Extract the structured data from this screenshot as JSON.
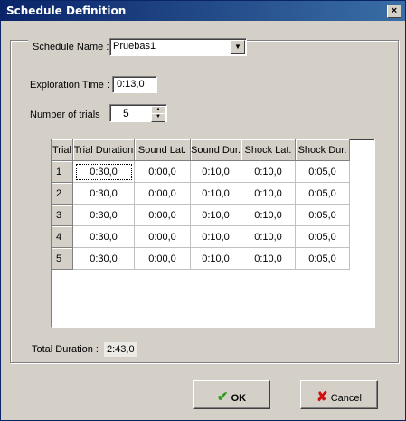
{
  "window": {
    "title": "Schedule Definition",
    "close_glyph": "×"
  },
  "schedule": {
    "label": "Schedule Name :",
    "value": "Pruebas1",
    "arrow_glyph": "▼"
  },
  "exploration": {
    "label": "Exploration Time :",
    "value": "0:13,0"
  },
  "trials": {
    "label": "Number of trials",
    "value": "5",
    "up_glyph": "▲",
    "down_glyph": "▼"
  },
  "grid": {
    "headers": [
      "Trial",
      "Trial Duration",
      "Sound Lat.",
      "Sound Dur.",
      "Shock Lat.",
      "Shock Dur."
    ],
    "rows": [
      [
        "1",
        "0:30,0",
        "0:00,0",
        "0:10,0",
        "0:10,0",
        "0:05,0"
      ],
      [
        "2",
        "0:30,0",
        "0:00,0",
        "0:10,0",
        "0:10,0",
        "0:05,0"
      ],
      [
        "3",
        "0:30,0",
        "0:00,0",
        "0:10,0",
        "0:10,0",
        "0:05,0"
      ],
      [
        "4",
        "0:30,0",
        "0:00,0",
        "0:10,0",
        "0:10,0",
        "0:05,0"
      ],
      [
        "5",
        "0:30,0",
        "0:00,0",
        "0:10,0",
        "0:10,0",
        "0:05,0"
      ]
    ]
  },
  "total": {
    "label": "Total Duration :",
    "value": "2:43,0"
  },
  "buttons": {
    "ok": "OK",
    "ok_icon": "✔",
    "cancel": "Cancel",
    "cancel_icon": "✘"
  },
  "colors": {
    "title_bar": "#0a246a",
    "ok_check": "#2e9b1e",
    "cancel_x": "#d01010"
  }
}
